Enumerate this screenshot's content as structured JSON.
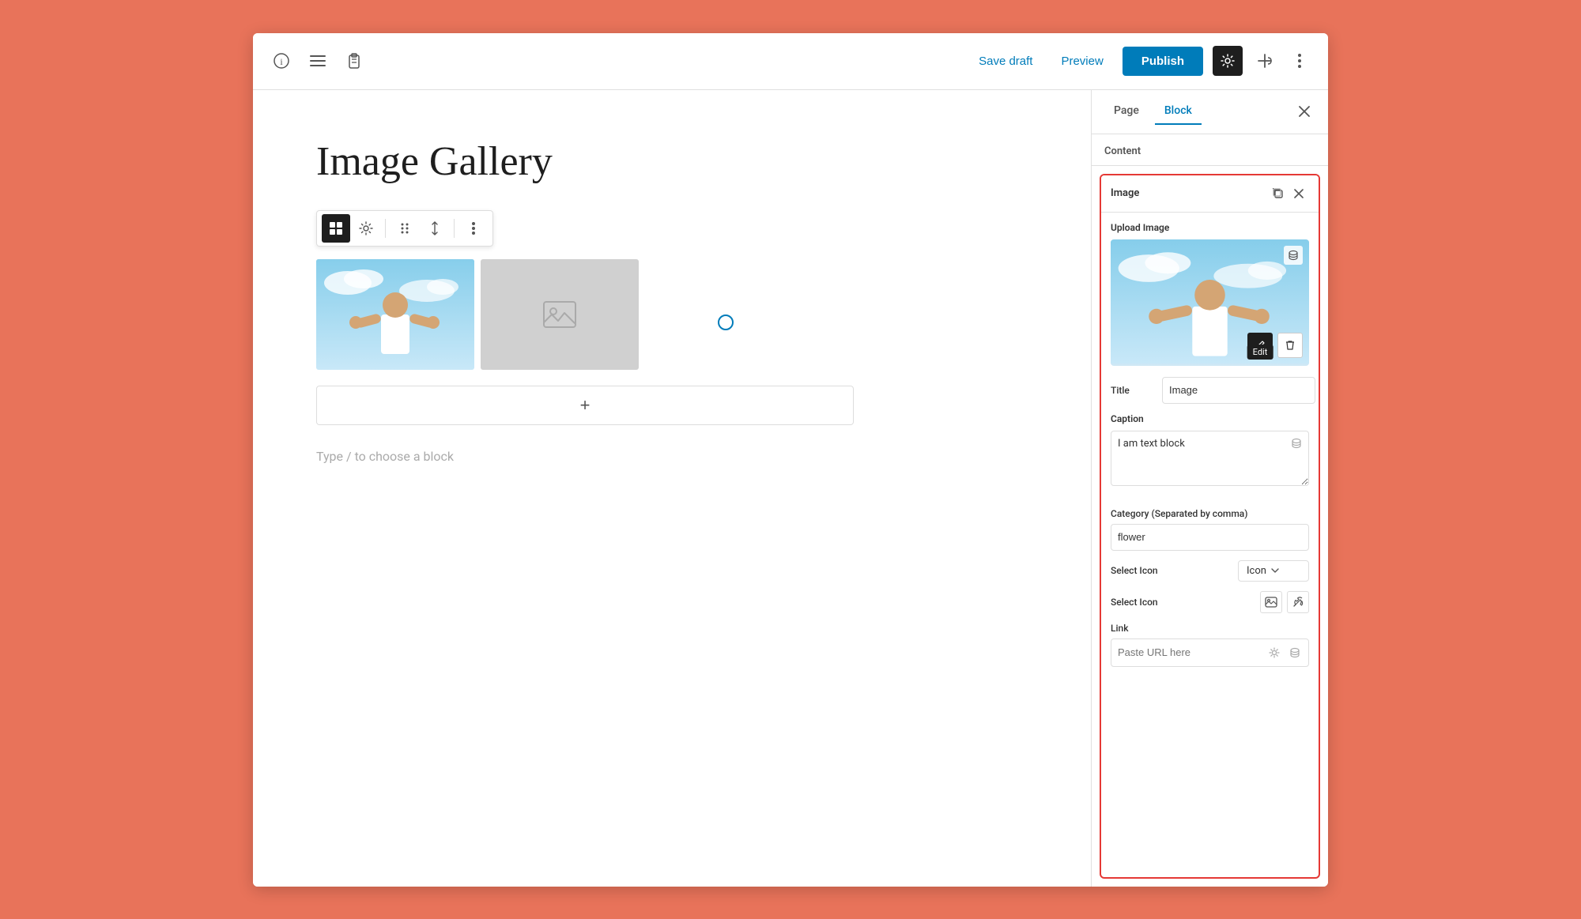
{
  "app": {
    "background_color": "#e8735a"
  },
  "toolbar": {
    "info_icon": "ℹ",
    "list_icon": "≡",
    "clipboard_icon": "📋",
    "save_draft_label": "Save draft",
    "preview_label": "Preview",
    "publish_label": "Publish",
    "gear_icon": "⚙",
    "plugin_icon": "✛",
    "more_icon": "⋮"
  },
  "editor": {
    "page_title": "Image Gallery",
    "type_prompt": "Type / to choose a block",
    "add_block_plus": "+"
  },
  "block_toolbar": {
    "gallery_icon": "▦",
    "settings_icon": "⚙",
    "drag_icon": "⠿",
    "arrows_icon": "⇅",
    "more_icon": "⋮"
  },
  "right_panel": {
    "tab_page": "Page",
    "tab_block": "Block",
    "tab_block_active": true,
    "close_icon": "✕",
    "content_label": "Content",
    "image_block": {
      "title": "Image",
      "copy_icon": "⧉",
      "close_icon": "✕",
      "upload_image_label": "Upload Image",
      "db_icon": "🗄",
      "edit_icon": "✏",
      "delete_icon": "🗑",
      "edit_label": "Edit",
      "title_label": "Title",
      "title_value": "Image",
      "caption_label": "Caption",
      "caption_value": "I am text block",
      "category_label": "Category (Separated by comma)",
      "category_value": "flower",
      "select_icon_label": "Select Icon",
      "select_icon_value": "Icon",
      "select_icon_chevron": "▾",
      "select_icon_label2": "Select Icon",
      "icon_image_btn": "🖼",
      "icon_wrench_btn": "🔧",
      "link_label": "Link",
      "link_placeholder": "Paste URL here",
      "link_gear_icon": "⚙",
      "link_db_icon": "🗄"
    }
  }
}
